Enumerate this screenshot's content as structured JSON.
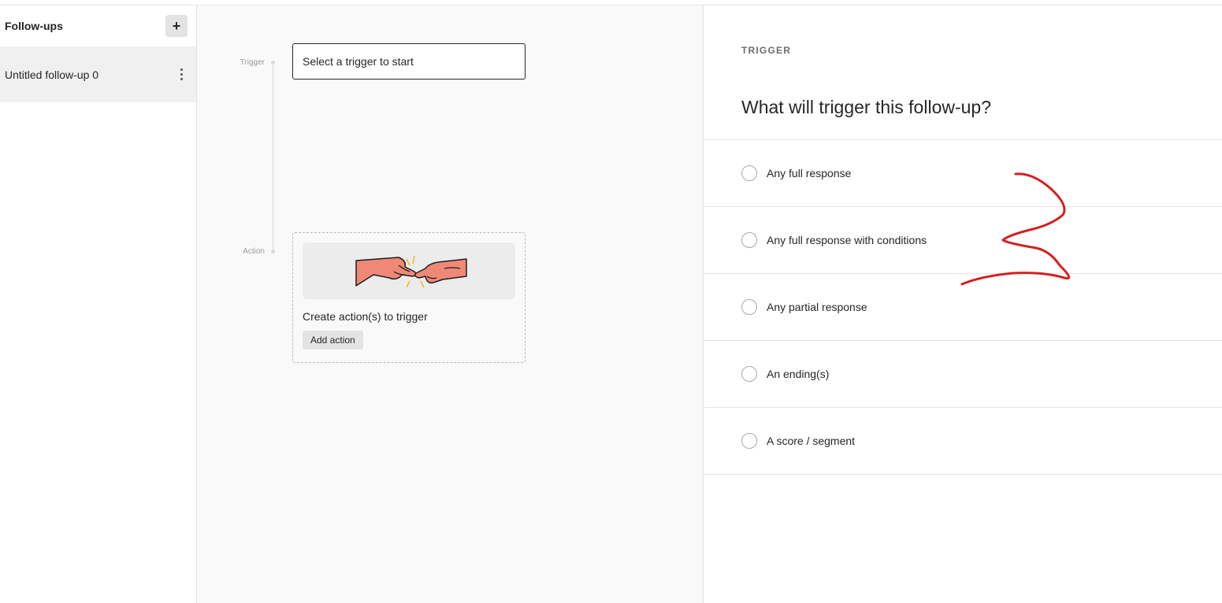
{
  "sidebar": {
    "title": "Follow-ups",
    "add_icon": "plus-icon",
    "items": [
      {
        "label": "Untitled follow-up 0",
        "menu_icon": "kebab-menu-icon"
      }
    ]
  },
  "canvas": {
    "trigger_label": "Trigger",
    "trigger_placeholder": "Select a trigger to start",
    "action_label": "Action",
    "action_text": "Create action(s) to trigger",
    "add_action": "Add action",
    "illustration_icon": "hands-touching-icon"
  },
  "panel": {
    "eyebrow": "TRIGGER",
    "question": "What will trigger this follow-up?",
    "options": [
      {
        "label": "Any full response",
        "selected": false
      },
      {
        "label": "Any full response with conditions",
        "selected": false
      },
      {
        "label": "Any partial response",
        "selected": false
      },
      {
        "label": "An ending(s)",
        "selected": false
      },
      {
        "label": "A score / segment",
        "selected": false
      }
    ]
  },
  "colors": {
    "annotation": "#d42020",
    "hand_fill": "#f08878",
    "spark": "#f5b82e"
  }
}
